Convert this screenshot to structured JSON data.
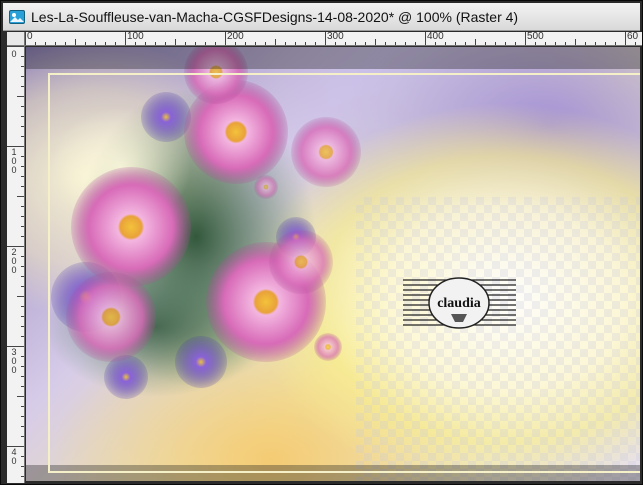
{
  "window": {
    "title": "Les-La-Souffleuse-van-Macha-CGSFDesigns-14-08-2020* @ 100% (Raster 4)",
    "app_icon": "paintshop-image-icon"
  },
  "rulers": {
    "horizontal_labels": [
      "0",
      "100",
      "200",
      "300",
      "400",
      "500",
      "60"
    ],
    "vertical_labels": [
      "0",
      "100",
      "200",
      "300",
      "40"
    ]
  },
  "canvas": {
    "watermark_text": "claudia"
  }
}
